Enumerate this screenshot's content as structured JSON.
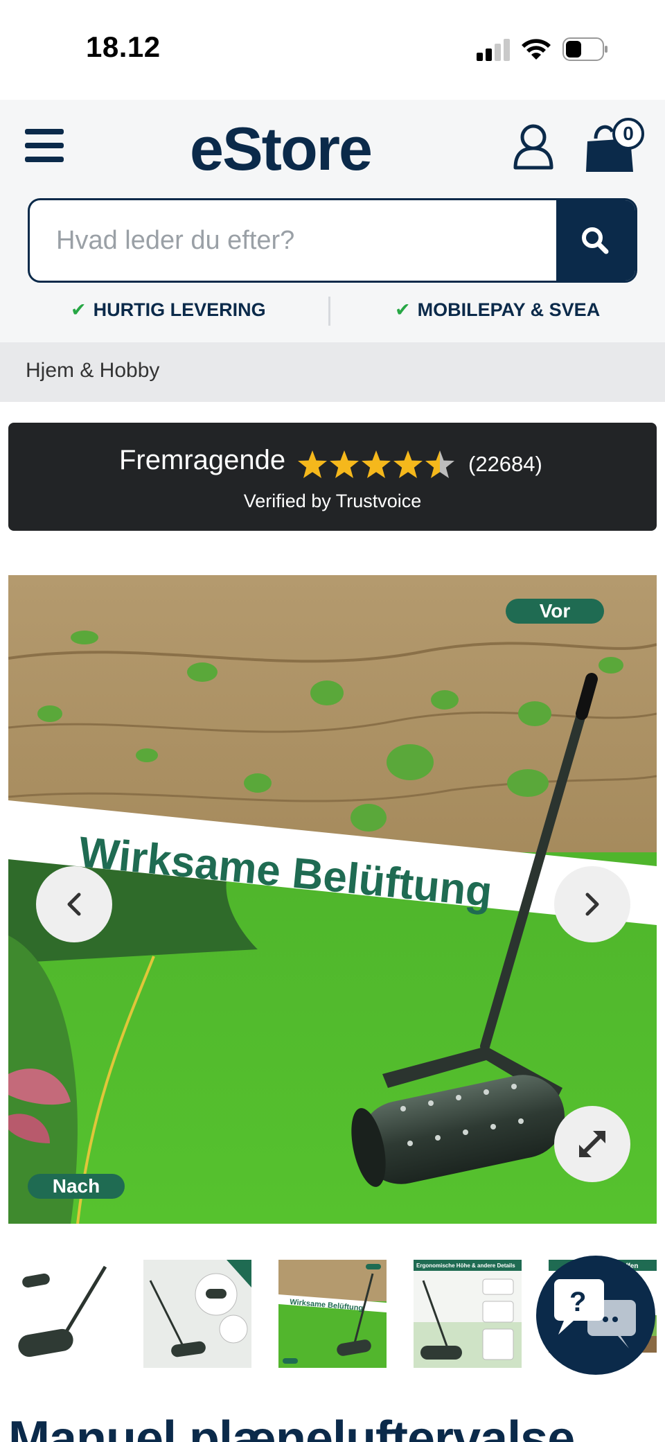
{
  "status_bar": {
    "time": "18.12",
    "icons": [
      "cellular-signal-icon",
      "wifi-icon",
      "battery-icon"
    ]
  },
  "header": {
    "logo": "eStore",
    "cart_count": "0",
    "search": {
      "placeholder": "Hvad leder du efter?"
    },
    "usps": [
      "HURTIG LEVERING",
      "MOBILEPAY & SVEA"
    ]
  },
  "breadcrumb": {
    "label": "Hjem & Hobby"
  },
  "trust": {
    "label": "Fremragende",
    "rating": 4.5,
    "max_rating": 5,
    "count": "(22684)",
    "verified": "Verified by Trustvoice"
  },
  "product_image": {
    "banner": "Wirksame Belüftung",
    "before_badge": "Vor",
    "after_badge": "Nach"
  },
  "thumbnails": [
    {
      "name": "thumb-roller-white"
    },
    {
      "name": "thumb-roller-dimensions"
    },
    {
      "name": "thumb-lawn-banner",
      "caption": "Wirksame Belüftung"
    },
    {
      "name": "thumb-ergonomic-details",
      "caption": "Ergonomische Höhe & andere Details"
    },
    {
      "name": "thumb-schaffen",
      "caption": "...che schaffen"
    }
  ],
  "product": {
    "title": "Manuel plæneluftervalse"
  },
  "colors": {
    "brand": "#0b2a4a",
    "accent_green": "#27a745",
    "star": "#f5b81c",
    "trust_bg": "#222426"
  }
}
